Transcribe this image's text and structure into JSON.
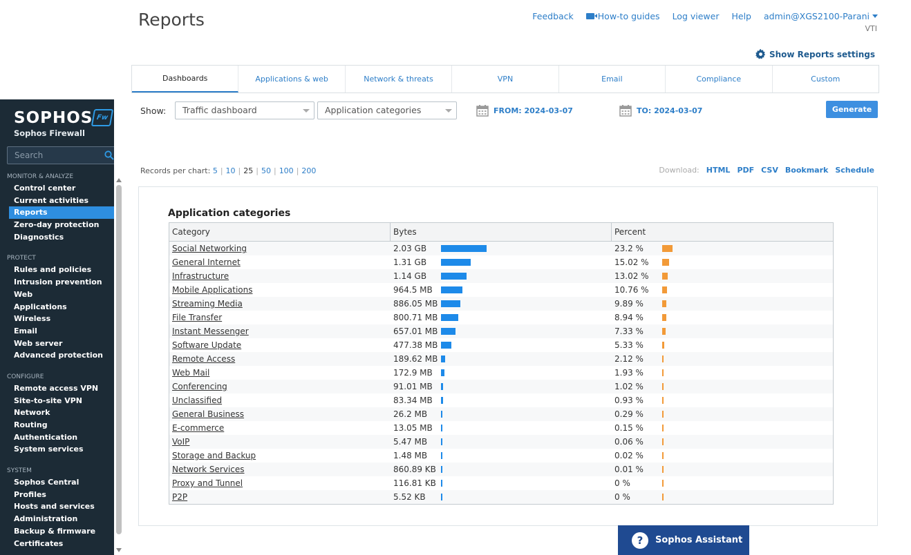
{
  "header": {
    "title": "Reports",
    "links": [
      "Feedback",
      "How-to guides",
      "Log viewer",
      "Help",
      "admin@XGS2100-Parani"
    ],
    "device": "VTI",
    "settings_label": "Show Reports settings"
  },
  "brand": {
    "name": "SOPHOS",
    "product": "Sophos Firewall",
    "badge": "Fw"
  },
  "sidebar": {
    "search_placeholder": "Search",
    "sections": [
      {
        "title": "MONITOR & ANALYZE",
        "items": [
          "Control center",
          "Current activities",
          "Reports",
          "Zero-day protection",
          "Diagnostics"
        ]
      },
      {
        "title": "PROTECT",
        "items": [
          "Rules and policies",
          "Intrusion prevention",
          "Web",
          "Applications",
          "Wireless",
          "Email",
          "Web server",
          "Advanced protection"
        ]
      },
      {
        "title": "CONFIGURE",
        "items": [
          "Remote access VPN",
          "Site-to-site VPN",
          "Network",
          "Routing",
          "Authentication",
          "System services"
        ]
      },
      {
        "title": "SYSTEM",
        "items": [
          "Sophos Central",
          "Profiles",
          "Hosts and services",
          "Administration",
          "Backup & firmware",
          "Certificates"
        ]
      }
    ],
    "active_item": "Reports"
  },
  "tabs": [
    "Dashboards",
    "Applications & web",
    "Network & threats",
    "VPN",
    "Email",
    "Compliance",
    "Custom"
  ],
  "active_tab": "Dashboards",
  "filters": {
    "show_label": "Show:",
    "dashboard": "Traffic dashboard",
    "category": "Application categories",
    "from": "FROM: 2024-03-07",
    "to": "TO: 2024-03-07",
    "generate": "Generate"
  },
  "records": {
    "label": "Records per chart:",
    "options": [
      "5",
      "10",
      "25",
      "50",
      "100",
      "200"
    ],
    "selected": "25"
  },
  "download": {
    "label": "Download:",
    "options": [
      "HTML",
      "PDF",
      "CSV",
      "Bookmark",
      "Schedule"
    ]
  },
  "report": {
    "title": "Application categories",
    "columns": [
      "Category",
      "Bytes",
      "Percent"
    ],
    "rows": [
      {
        "category": "Social Networking",
        "bytes": "2.03 GB",
        "percent": "23.2 %",
        "pct": 23.2
      },
      {
        "category": "General Internet",
        "bytes": "1.31 GB",
        "percent": "15.02 %",
        "pct": 15.02
      },
      {
        "category": "Infrastructure",
        "bytes": "1.14 GB",
        "percent": "13.02 %",
        "pct": 13.02
      },
      {
        "category": "Mobile Applications",
        "bytes": "964.5 MB",
        "percent": "10.76 %",
        "pct": 10.76
      },
      {
        "category": "Streaming Media",
        "bytes": "886.05 MB",
        "percent": "9.89 %",
        "pct": 9.89
      },
      {
        "category": "File Transfer",
        "bytes": "800.71 MB",
        "percent": "8.94 %",
        "pct": 8.94
      },
      {
        "category": "Instant Messenger",
        "bytes": "657.01 MB",
        "percent": "7.33 %",
        "pct": 7.33
      },
      {
        "category": "Software Update",
        "bytes": "477.38 MB",
        "percent": "5.33 %",
        "pct": 5.33
      },
      {
        "category": "Remote Access",
        "bytes": "189.62 MB",
        "percent": "2.12 %",
        "pct": 2.12
      },
      {
        "category": "Web Mail",
        "bytes": "172.9 MB",
        "percent": "1.93 %",
        "pct": 1.93
      },
      {
        "category": "Conferencing",
        "bytes": "91.01 MB",
        "percent": "1.02 %",
        "pct": 1.02
      },
      {
        "category": "Unclassified",
        "bytes": "83.34 MB",
        "percent": "0.93 %",
        "pct": 0.93
      },
      {
        "category": "General Business",
        "bytes": "26.2 MB",
        "percent": "0.29 %",
        "pct": 0.29
      },
      {
        "category": "E-commerce",
        "bytes": "13.05 MB",
        "percent": "0.15 %",
        "pct": 0.15
      },
      {
        "category": "VoIP",
        "bytes": "5.47 MB",
        "percent": "0.06 %",
        "pct": 0.06
      },
      {
        "category": "Storage and Backup",
        "bytes": "1.48 MB",
        "percent": "0.02 %",
        "pct": 0.02
      },
      {
        "category": "Network Services",
        "bytes": "860.89 KB",
        "percent": "0.01 %",
        "pct": 0.01
      },
      {
        "category": "Proxy and Tunnel",
        "bytes": "116.81 KB",
        "percent": "0 %",
        "pct": 0
      },
      {
        "category": "P2P",
        "bytes": "5.52 KB",
        "percent": "0 %",
        "pct": 0
      }
    ]
  },
  "assistant": {
    "label": "Sophos Assistant"
  },
  "colors": {
    "bytes_bar": "#1d8ae9",
    "percent_bar": "#f29a38",
    "sidebar_bg": "#1c2b36",
    "accent": "#2d7ec8"
  }
}
